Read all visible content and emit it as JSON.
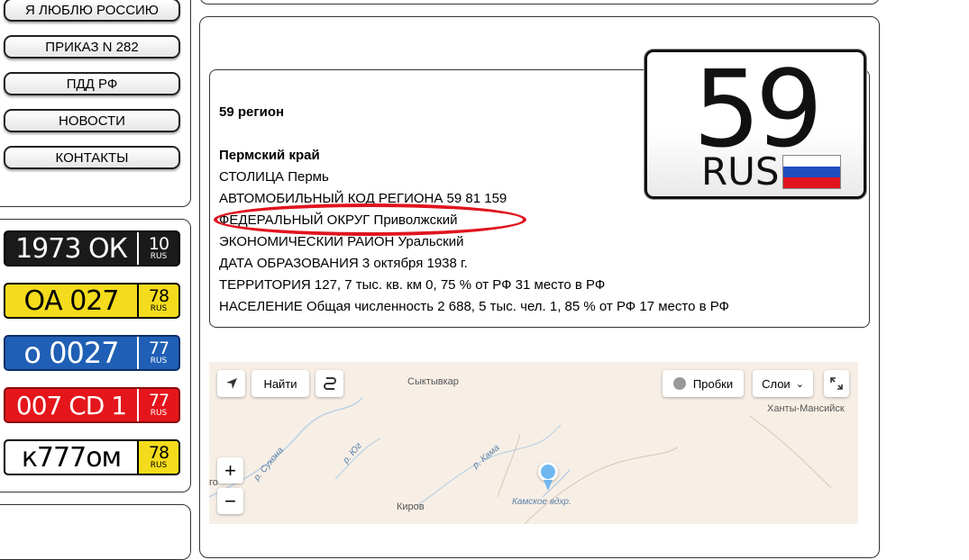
{
  "nav": {
    "items": [
      {
        "label": "Я ЛЮБЛЮ РОССИЮ"
      },
      {
        "label": "ПРИКАЗ N 282"
      },
      {
        "label": "ПДД РФ"
      },
      {
        "label": "НОВОСТИ"
      },
      {
        "label": "КОНТАКТЫ"
      }
    ]
  },
  "plates": [
    {
      "main": "1973 ОК",
      "region": "10",
      "rus": "RUS",
      "bg": "#1a1a1a",
      "fg": "#ffffff"
    },
    {
      "main": "ОА 027",
      "region": "78",
      "rus": "RUS",
      "bg": "#f4dc1c",
      "fg": "#000000"
    },
    {
      "main": "о 0027",
      "region": "77",
      "rus": "RUS",
      "bg": "#1f5fb5",
      "fg": "#ffffff"
    },
    {
      "main": "007 CD 1",
      "region": "77",
      "rus": "RUS",
      "bg": "#e4161b",
      "fg": "#ffffff"
    },
    {
      "main": "к777ом",
      "region": "78",
      "rus": "RUS",
      "bg": "#ffffff",
      "fg": "#000000",
      "region_bg": "#f4dc1c"
    }
  ],
  "info": {
    "title": "59 регион",
    "region_name": "Пермский край",
    "lines": [
      "СТОЛИЦА Пермь",
      "АВТОМОБИЛЬНЫЙ КОД РЕГИОНА 59 81 159",
      "ФЕДЕРАЛЬНЫЙ ОКРУГ Приволжский",
      "ЭКОНОМИЧЕСКИЙ РАЙОН Уральский",
      "ДАТА ОБРАЗОВАНИЯ 3 октября 1938 г.",
      "ТЕРРИТОРИЯ 127, 7 тыс. кв. км 0, 75 % от РФ 31 место в РФ",
      "НАСЕЛЕНИЕ Общая численность 2 688, 5 тыс. чел. 1, 85 % от РФ 17 место в РФ"
    ]
  },
  "big_plate": {
    "number": "59",
    "rus": "RUS"
  },
  "map": {
    "find_label": "Найти",
    "traffic_label": "Пробки",
    "layers_label": "Слои",
    "zoom_in": "+",
    "zoom_out": "−",
    "cities": [
      "Сыктывкар",
      "Ханты-Мансийск",
      "Киров",
      "Камское вдхр."
    ],
    "rivers": [
      "р. Сухона",
      "р. Юг",
      "р. Кама"
    ],
    "edge_text": "го"
  },
  "colors": {
    "oval": "#e0141e",
    "flag_white": "#ffffff",
    "flag_blue": "#1f4fbf",
    "flag_red": "#e0141e"
  }
}
